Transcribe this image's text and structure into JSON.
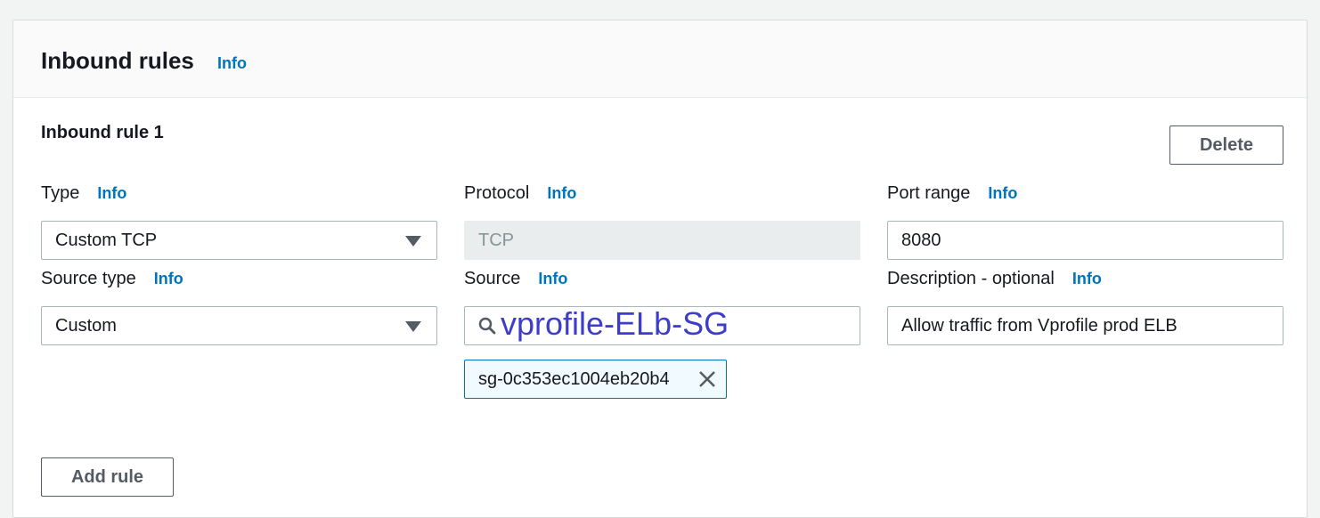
{
  "panel": {
    "title": "Inbound rules",
    "info": "Info"
  },
  "rule": {
    "title": "Inbound rule 1",
    "delete_label": "Delete",
    "type": {
      "label": "Type",
      "info": "Info",
      "value": "Custom TCP"
    },
    "protocol": {
      "label": "Protocol",
      "info": "Info",
      "value": "TCP"
    },
    "port_range": {
      "label": "Port range",
      "info": "Info",
      "value": "8080"
    },
    "source_type": {
      "label": "Source type",
      "info": "Info",
      "value": "Custom"
    },
    "source": {
      "label": "Source",
      "info": "Info",
      "value": "vprofile-ELb-SG",
      "token": "sg-0c353ec1004eb20b4"
    },
    "description": {
      "label": "Description - optional",
      "info": "Info",
      "value": "Allow traffic from Vprofile prod ELB"
    }
  },
  "add_rule_label": "Add rule",
  "icons": {
    "search": "search-icon",
    "dropdown": "caret-down-icon",
    "remove": "close-icon"
  },
  "colors": {
    "link": "#0073bb",
    "source_text": "#3c3ec9",
    "token_bg": "#f1faff"
  }
}
